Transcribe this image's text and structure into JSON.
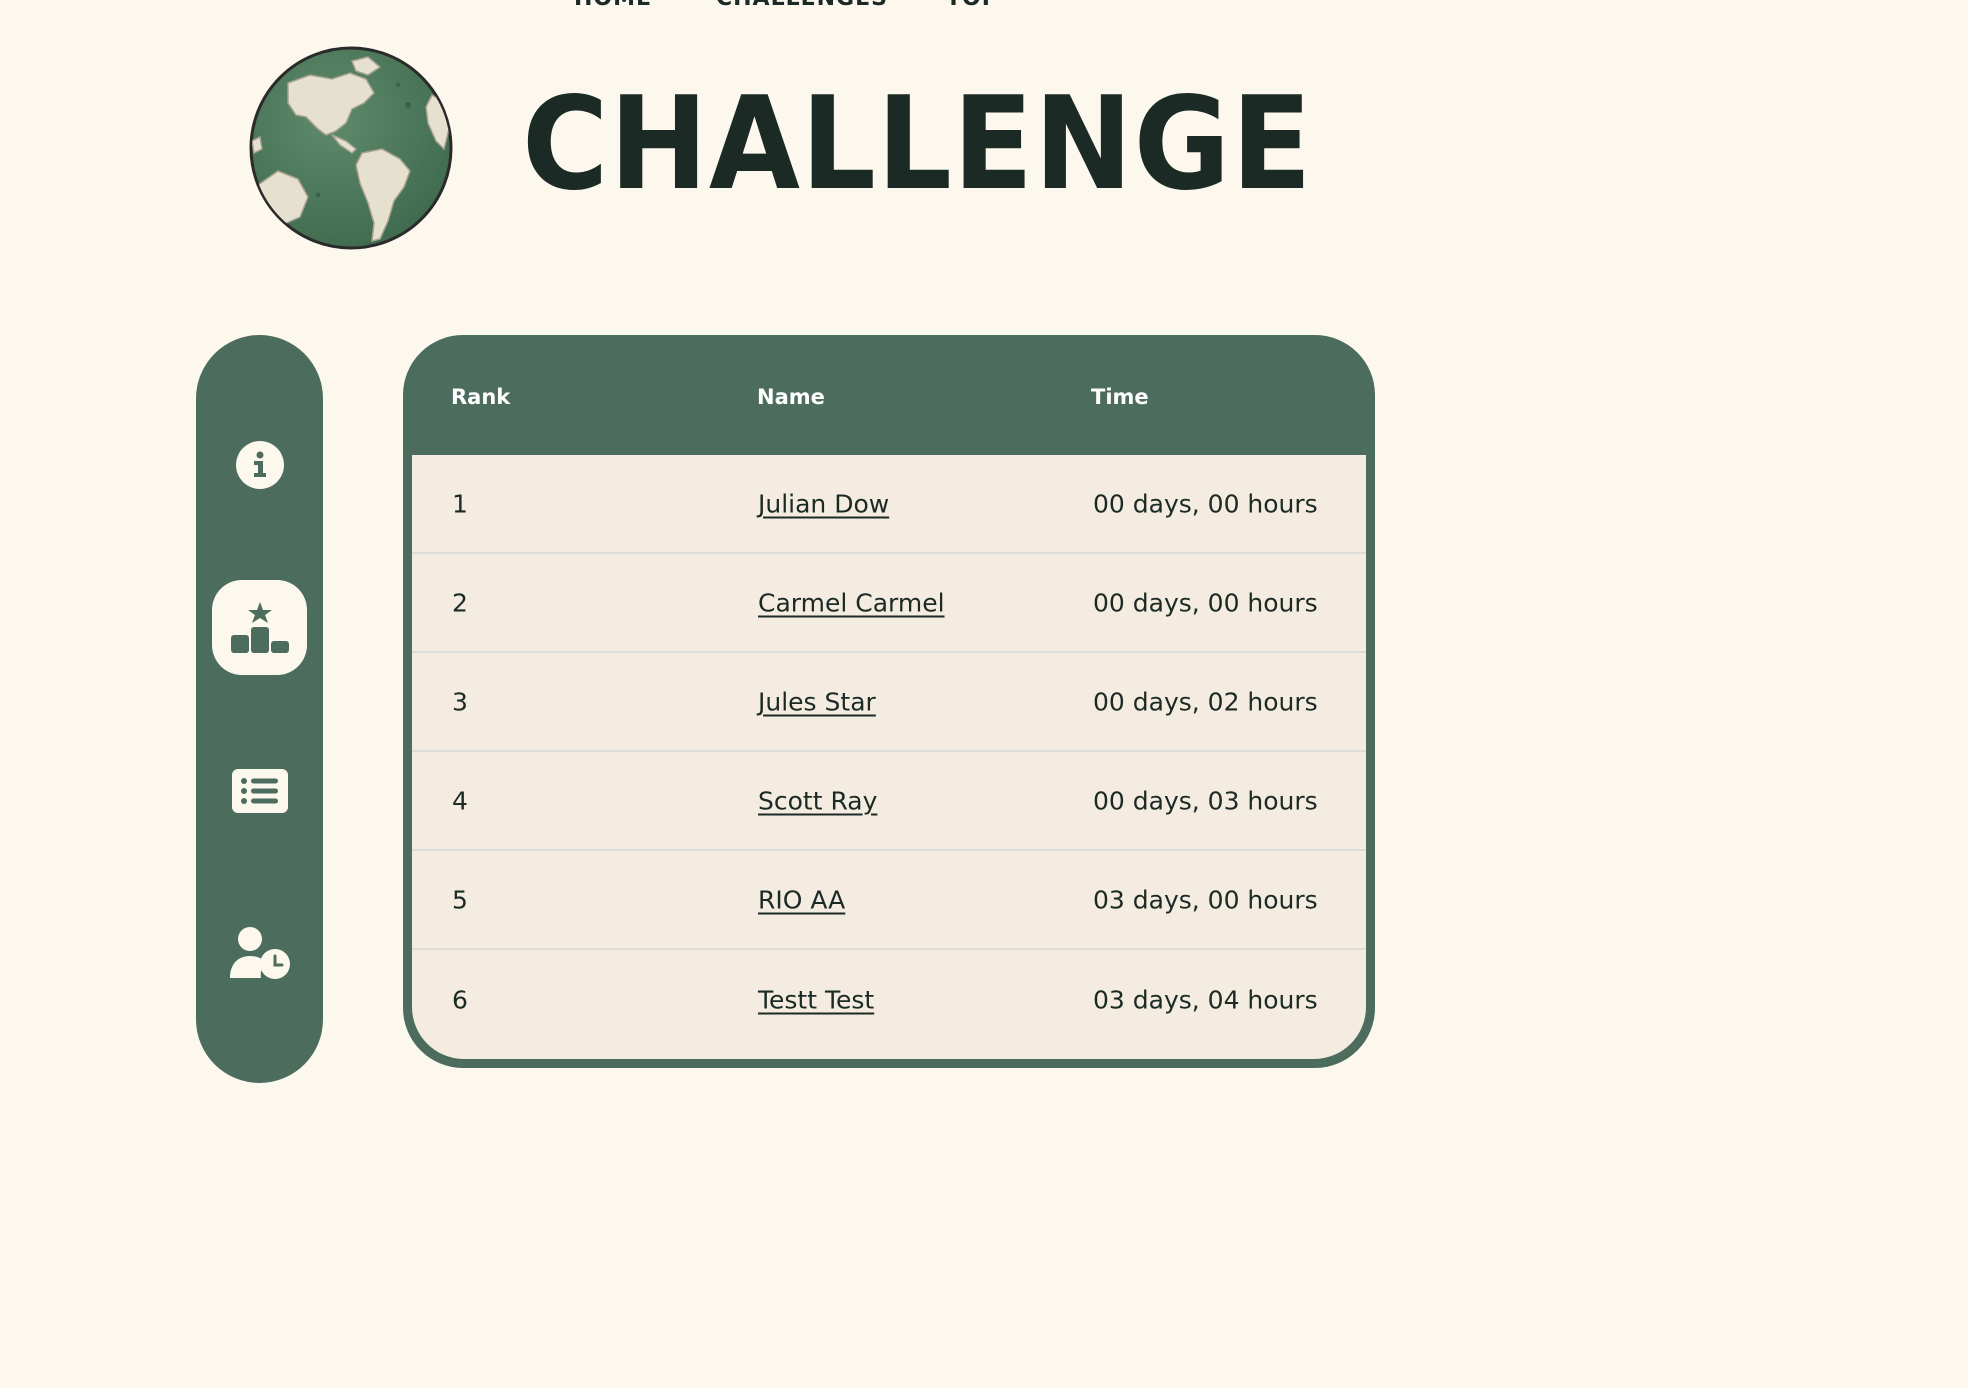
{
  "nav": {
    "home": "HOME",
    "challenges": "CHALLENGES",
    "top": "TOP"
  },
  "title": "CHALLENGE",
  "colors": {
    "background": "#fdf8ee",
    "accent_green": "#4c6c5e",
    "dark_text": "#1b2a25",
    "table_row_bg": "#f5ece1"
  },
  "sidebar": {
    "items": [
      {
        "icon": "info-icon",
        "active": false
      },
      {
        "icon": "leaderboard-podium-icon",
        "active": true
      },
      {
        "icon": "list-icon",
        "active": false
      },
      {
        "icon": "user-clock-icon",
        "active": false
      }
    ]
  },
  "table": {
    "headers": {
      "rank": "Rank",
      "name": "Name",
      "time": "Time"
    },
    "rows": [
      {
        "rank": "1",
        "name": "Julian Dow",
        "time": "00 days, 00 hours"
      },
      {
        "rank": "2",
        "name": "Carmel Carmel",
        "time": "00 days, 00 hours"
      },
      {
        "rank": "3",
        "name": "Jules Star",
        "time": "00 days, 02 hours"
      },
      {
        "rank": "4",
        "name": "Scott Ray",
        "time": "00 days, 03 hours"
      },
      {
        "rank": "5",
        "name": "RIO AA",
        "time": "03 days, 00 hours"
      },
      {
        "rank": "6",
        "name": "Testt Test",
        "time": "03 days, 04 hours"
      }
    ]
  }
}
